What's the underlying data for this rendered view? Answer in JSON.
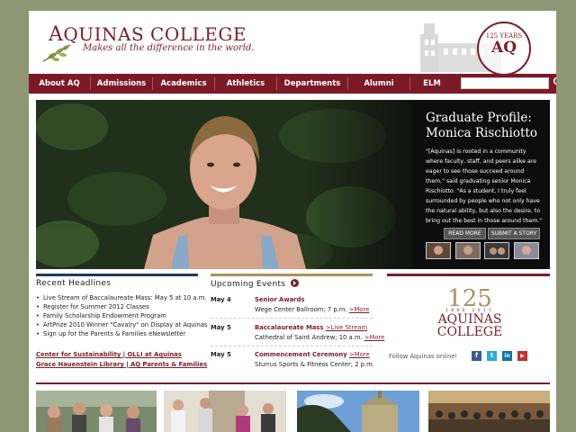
{
  "header": {
    "college_name_initial": "A",
    "college_name_rest": "QUINAS COLLEGE",
    "tagline": "Makes all the difference in the world.",
    "seal_years": "125 YEARS",
    "seal_initials": "AQ"
  },
  "nav": {
    "items": [
      {
        "label": "About AQ"
      },
      {
        "label": "Admissions"
      },
      {
        "label": "Academics"
      },
      {
        "label": "Athletics"
      },
      {
        "label": "Departments"
      },
      {
        "label": "Alumni"
      },
      {
        "label": "ELM"
      }
    ],
    "search_value": "",
    "search_icon": "search-icon"
  },
  "hero": {
    "title": "Graduate Profile: Monica Rischiotto",
    "text": "\"[Aquinas] is rooted in a community where faculty, staff, and peers alike are eager to see those succeed around them,\" said graduating senior Monica Rischiotto. \"As a student, I truly feel surrounded by people who not only have the natural ability, but also the desire, to bring out the best in those around them.\"",
    "read_more": "READ MORE",
    "submit_story": "SUBMIT A STORY"
  },
  "headlines": {
    "title": "Recent Headlines",
    "items": [
      "Live Stream of Baccalaureate Mass: May 5 at 10 a.m.",
      "Register for Summer 2012 Classes",
      "Family Scholarship Endowment Program",
      "ArtPrize 2010 Winner \"Cavalry\" on Display at Aquinas",
      "Sign up for the Parents & Families eNewsletter"
    ],
    "link1": "Center for Sustainability",
    "link2": "OLLI at Aquinas",
    "link3": "Grace Hauenstein Library",
    "link4": "AQ Parents & Families",
    "separator": "|"
  },
  "events": {
    "title": "Upcoming Events",
    "items": [
      {
        "date": "May 4",
        "title": "Senior Awards",
        "extra": "",
        "location": "Wege Center Ballroom; 7 p.m.",
        "more": ">More"
      },
      {
        "date": "May 5",
        "title": "Baccalaureate Mass",
        "extra": ">Live Stream",
        "location": "Cathedral of Saint Andrew; 10 a.m.",
        "more": ">More"
      },
      {
        "date": "May 5",
        "title": "Commencement Ceremony",
        "extra": ">More",
        "location": "Sturrus Sports & Fitness Center; 2 p.m.",
        "more": ""
      }
    ]
  },
  "sidebar": {
    "logo_number": "125",
    "logo_years": "1886 2011",
    "logo_line1": "AQUINAS",
    "logo_line2": "COLLEGE",
    "follow_text": "Follow Aquinas online!",
    "social": [
      {
        "icon": "facebook-icon",
        "glyph": "f",
        "color": "#3b5998"
      },
      {
        "icon": "twitter-icon",
        "glyph": "t",
        "color": "#29a9e1"
      },
      {
        "icon": "linkedin-icon",
        "glyph": "in",
        "color": "#0e76a8"
      },
      {
        "icon": "youtube-icon",
        "glyph": "▶",
        "color": "#c4302b"
      }
    ]
  },
  "colors": {
    "brand": "#7b1d2c",
    "page_bg": "#8f9774",
    "accent_gold": "#a9925e",
    "rule_blue": "#1f3b5a"
  }
}
